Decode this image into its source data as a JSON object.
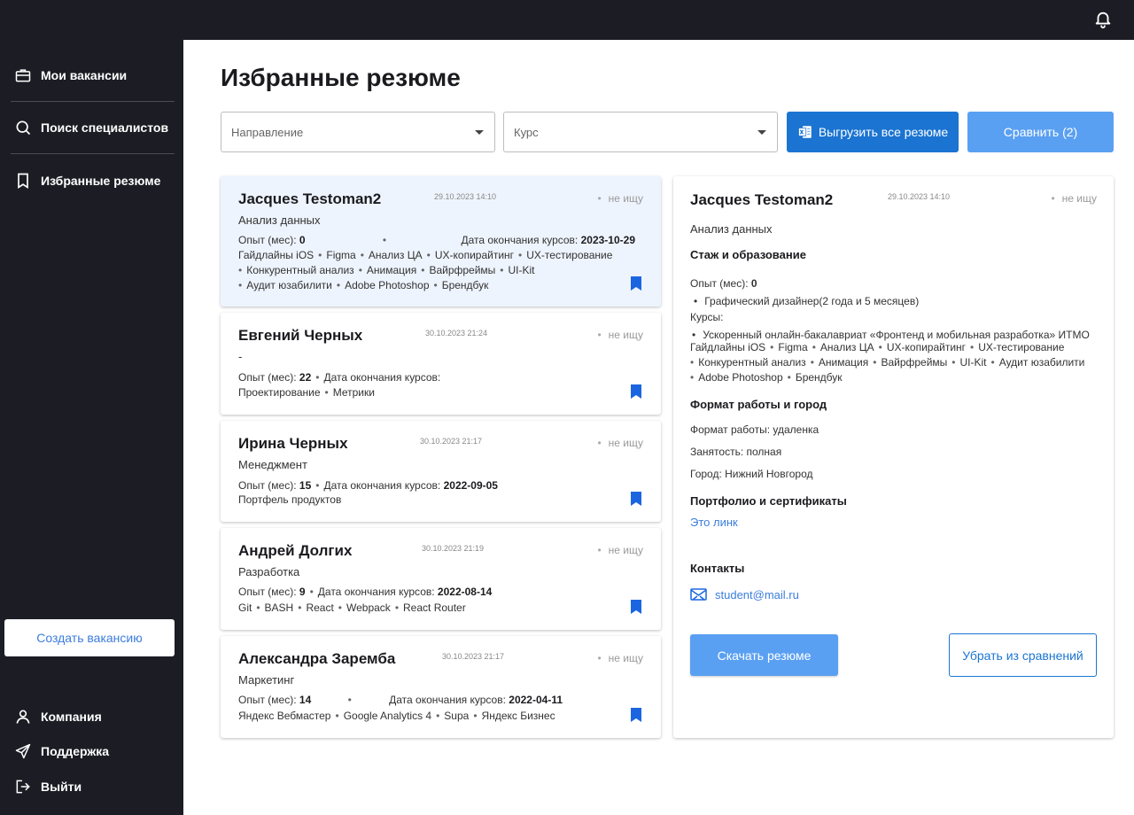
{
  "nav": {
    "items": [
      {
        "label": "Мои вакансии",
        "icon": "briefcase-icon"
      },
      {
        "label": "Поиск специалистов",
        "icon": "search-icon"
      },
      {
        "label": "Избранные резюме",
        "icon": "bookmark-icon"
      }
    ],
    "create_button": "Создать вакансию",
    "bottom": [
      {
        "label": "Компания",
        "icon": "user-icon"
      },
      {
        "label": "Поддержка",
        "icon": "send-icon"
      },
      {
        "label": "Выйти",
        "icon": "logout-icon"
      }
    ]
  },
  "page": {
    "title": "Избранные резюме"
  },
  "filters": {
    "direction_placeholder": "Направление",
    "course_placeholder": "Курс",
    "export_label": "Выгрузить все резюме",
    "compare_label": "Сравнить (2)"
  },
  "colors": {
    "accent": "#1b74d1",
    "accent_light": "#5aa0f2",
    "sidebar": "#1c1d24",
    "active_card": "#eef4fd"
  },
  "cards": [
    {
      "name": "Jacques Testoman2",
      "date": "29.10.2023 14:10",
      "status": "не ищу",
      "direction": "Анализ данных",
      "experience_label": "Опыт (мес):",
      "experience": "0",
      "course_end_label": "Дата окончания курсов:",
      "course_end": "2023-10-29",
      "skills_lines": [
        [
          "Гайдлайны iOS",
          "Figma",
          "Анализ ЦА",
          "UX-копирайтинг",
          "UX-тестирование"
        ],
        [
          "Конкурентный анализ",
          "Анимация",
          "Вайрфреймы",
          "UI-Kit"
        ],
        [
          "Аудит юзабилити",
          "Adobe Photoshop",
          "Брендбук"
        ]
      ]
    },
    {
      "name": "Евгений Черных",
      "date": "30.10.2023 21:24",
      "status": "не ищу",
      "direction": "-",
      "experience_label": "Опыт (мес):",
      "experience": "22",
      "course_end_label": "Дата окончания курсов:",
      "course_end": "",
      "skills_lines": [
        [
          "Проектирование",
          "Метрики"
        ]
      ]
    },
    {
      "name": "Ирина Черных",
      "date": "30.10.2023 21:17",
      "status": "не ищу",
      "direction": "Менеджмент",
      "experience_label": "Опыт (мес):",
      "experience": "15",
      "course_end_label": "Дата окончания курсов:",
      "course_end": "2022-09-05",
      "skills_lines": [
        [
          "Портфель продуктов"
        ]
      ]
    },
    {
      "name": "Андрей Долгих",
      "date": "30.10.2023 21:19",
      "status": "не ищу",
      "direction": "Разработка",
      "experience_label": "Опыт (мес):",
      "experience": "9",
      "course_end_label": "Дата окончания курсов:",
      "course_end": "2022-08-14",
      "skills_lines": [
        [
          "Git",
          "BASH",
          "React",
          "Webpack",
          "React Router"
        ]
      ]
    },
    {
      "name": "Александра Заремба",
      "date": "30.10.2023 21:17",
      "status": "не ищу",
      "direction": "Маркетинг",
      "experience_label": "Опыт (мес):",
      "experience": "14",
      "course_end_label": "Дата окончания курсов:",
      "course_end": "2022-04-11",
      "skills_lines": [
        [
          "Яндекс Вебмастер",
          "Google Analytics 4",
          "Supa",
          "Яндекс Бизнес"
        ]
      ]
    }
  ],
  "detail": {
    "name": "Jacques Testoman2",
    "date": "29.10.2023 14:10",
    "status": "не ищу",
    "direction": "Анализ данных",
    "section_experience": "Стаж и образование",
    "experience_label": "Опыт (мес):",
    "experience": "0",
    "experience_item": "Графический дизайнер(2 года и 5 месяцев)",
    "courses_label": "Курсы:",
    "course_item": "Ускоренный онлайн-бакалавриат «Фронтенд и мобильная разработка» ИТМО",
    "skills_lines": [
      [
        "Гайдлайны iOS",
        "Figma",
        "Анализ ЦА",
        "UX-копирайтинг",
        "UX-тестирование"
      ],
      [
        "Конкурентный анализ",
        "Анимация",
        "Вайрфреймы",
        "UI-Kit",
        "Аудит юзабилити"
      ],
      [
        "Adobe Photoshop",
        "Брендбук"
      ]
    ],
    "section_format": "Формат работы и город",
    "format": "Формат работы: удаленка",
    "employment": "Занятость: полная",
    "city": "Город: Нижний Новгород",
    "section_portfolio": "Портфолио и сертификаты",
    "portfolio_link": "Это линк",
    "section_contacts": "Контакты",
    "email": "student@mail.ru",
    "download_label": "Скачать резюме",
    "remove_label": "Убрать из сравнений"
  }
}
